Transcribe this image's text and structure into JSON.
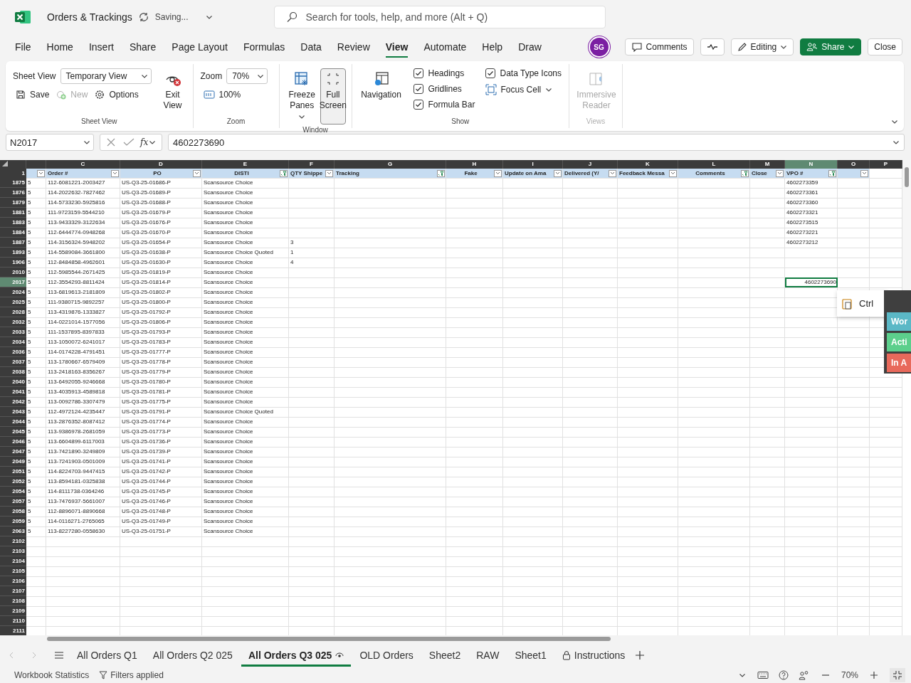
{
  "title_bar": {
    "document_title": "Orders & Trackings",
    "save_status": "Saving...",
    "search": {
      "placeholder": "Search for tools, help, and more (Alt + Q)"
    }
  },
  "menu_tabs": [
    {
      "label": "File",
      "selected": false
    },
    {
      "label": "Home",
      "selected": false
    },
    {
      "label": "Insert",
      "selected": false
    },
    {
      "label": "Share",
      "selected": false
    },
    {
      "label": "Page Layout",
      "selected": false
    },
    {
      "label": "Formulas",
      "selected": false
    },
    {
      "label": "Data",
      "selected": false
    },
    {
      "label": "Review",
      "selected": false
    },
    {
      "label": "View",
      "selected": true
    },
    {
      "label": "Automate",
      "selected": false
    },
    {
      "label": "Help",
      "selected": false
    },
    {
      "label": "Draw",
      "selected": false
    }
  ],
  "account": {
    "initials": "SG"
  },
  "actions": [
    {
      "kind": "comments",
      "label": "Comments"
    },
    {
      "kind": "activity"
    },
    {
      "kind": "editing",
      "label": "Editing"
    },
    {
      "kind": "share",
      "label": "Share"
    },
    {
      "kind": "close",
      "label": "Close"
    }
  ],
  "ribbon": {
    "sheet_view": {
      "label": "Sheet View",
      "field_label": "Sheet View",
      "view_value": "Temporary View",
      "exit": "Exit View",
      "buttons": [
        {
          "kind": "save",
          "label": "Save",
          "disabled": false
        },
        {
          "kind": "new",
          "label": "New",
          "disabled": true
        },
        {
          "kind": "options",
          "label": "Options",
          "disabled": false
        }
      ]
    },
    "zoom": {
      "label": "Zoom",
      "field_label": "Zoom",
      "value": "70%",
      "reset": "100%"
    },
    "window": {
      "label": "Window",
      "freeze": "Freeze Panes",
      "full_screen": {
        "label": "Full Screen",
        "selected": true
      }
    },
    "show": {
      "label": "Show",
      "navigation": "Navigation",
      "checks": [
        {
          "label": "Headings",
          "checked": true
        },
        {
          "label": "Gridlines",
          "checked": true
        },
        {
          "label": "Formula Bar",
          "checked": true
        },
        {
          "label": "Data Type Icons",
          "checked": true
        }
      ],
      "focus_cell": "Focus Cell"
    },
    "views": {
      "label": "Views",
      "immersive": "Immersive Reader",
      "disabled": true
    }
  },
  "formula_bar": {
    "name_box": "N2017",
    "function_label": "fx",
    "formula": "4602273690"
  },
  "grid": {
    "header_row": "1",
    "columns": [
      {
        "filtered": false,
        "selected": false
      },
      {
        "letter": "C",
        "header": "Order #",
        "filtered": false,
        "selected": false
      },
      {
        "letter": "D",
        "header": "PO",
        "filtered": false,
        "selected": false
      },
      {
        "letter": "E",
        "header": "DISTI",
        "filtered": true,
        "selected": false
      },
      {
        "letter": "F",
        "header": "QTY Shippe",
        "filtered": false,
        "selected": false
      },
      {
        "letter": "G",
        "header": "Tracking",
        "filtered": true,
        "selected": false
      },
      {
        "letter": "H",
        "header": "Fake",
        "filtered": false,
        "selected": false
      },
      {
        "letter": "I",
        "header": "Update on Ama",
        "filtered": false,
        "selected": false
      },
      {
        "letter": "J",
        "header": "Delivered (Y/",
        "filtered": false,
        "selected": false
      },
      {
        "letter": "K",
        "header": "Feedback Messa",
        "filtered": false,
        "selected": false
      },
      {
        "letter": "L",
        "header": "Comments",
        "filtered": true,
        "selected": false
      },
      {
        "letter": "M",
        "header": "Close",
        "filtered": false,
        "selected": false
      },
      {
        "letter": "N",
        "header": "VPO #",
        "filtered": true,
        "selected": true
      },
      {
        "letter": "O",
        "filtered": false,
        "selected": false
      },
      {
        "letter": "P",
        "selected": false
      }
    ],
    "rows": [
      {
        "row": "1875",
        "selected": false,
        "b": "5",
        "order_no": "112-6081221-2003427",
        "po": "US-Q3-25-01686-P",
        "disti": "Scansource Choice",
        "vpo": "4602273359"
      },
      {
        "row": "1876",
        "selected": false,
        "b": "5",
        "order_no": "114-2022632-7827462",
        "po": "US-Q3-25-01689-P",
        "disti": "Scansource Choice",
        "vpo": "4602273361"
      },
      {
        "row": "1879",
        "selected": false,
        "b": "5",
        "order_no": "114-5733230-5925816",
        "po": "US-Q3-25-01688-P",
        "disti": "Scansource Choice",
        "vpo": "4602273360"
      },
      {
        "row": "1881",
        "selected": false,
        "b": "5",
        "order_no": "111-9723159-5544210",
        "po": "US-Q3-25-01679-P",
        "disti": "Scansource Choice",
        "vpo": "4602273321"
      },
      {
        "row": "1883",
        "selected": false,
        "b": "5",
        "order_no": "113-9433329-3122634",
        "po": "US-Q3-25-01676-P",
        "disti": "Scansource Choice",
        "vpo": "4602273515"
      },
      {
        "row": "1884",
        "selected": false,
        "b": "5",
        "order_no": "112-6444774-0948268",
        "po": "US-Q3-25-01670-P",
        "disti": "Scansource Choice",
        "vpo": "4602273221"
      },
      {
        "row": "1887",
        "selected": false,
        "b": "5",
        "order_no": "114-3156324-5948202",
        "po": "US-Q3-25-01654-P",
        "disti": "Scansource Choice",
        "qty_shipped": "3",
        "vpo": "4602273212"
      },
      {
        "row": "1893",
        "selected": false,
        "b": "5",
        "order_no": "114-5589084-3661800",
        "po": "US-Q3-25-01638-P",
        "disti": "Scansource Choice Quoted",
        "qty_shipped": "1"
      },
      {
        "row": "1906",
        "selected": false,
        "b": "5",
        "order_no": "112-8484858-4962601",
        "po": "US-Q3-25-01630-P",
        "disti": "Scansource Choice",
        "qty_shipped": "4"
      },
      {
        "row": "2010",
        "selected": false,
        "b": "5",
        "order_no": "112-5985544-2671425",
        "po": "US-Q3-25-01819-P",
        "disti": "Scansource Choice"
      },
      {
        "row": "2017",
        "selected": true,
        "b": "5",
        "order_no": "112-3554293-8811424",
        "po": "US-Q3-25-01814-P",
        "disti": "Scansource Choice",
        "vpo": "4602273690"
      },
      {
        "row": "2024",
        "selected": false,
        "b": "5",
        "order_no": "113-6819613-2181809",
        "po": "US-Q3-25-01802-P",
        "disti": "Scansource Choice"
      },
      {
        "row": "2025",
        "selected": false,
        "b": "5",
        "order_no": "111-9380715-9892257",
        "po": "US-Q3-25-01800-P",
        "disti": "Scansource Choice"
      },
      {
        "row": "2028",
        "selected": false,
        "b": "5",
        "order_no": "113-4319876-1333827",
        "po": "US-Q3-25-01792-P",
        "disti": "Scansource Choice"
      },
      {
        "row": "2032",
        "selected": false,
        "b": "5",
        "order_no": "114-0221014-1577056",
        "po": "US-Q3-25-01806-P",
        "disti": "Scansource Choice"
      },
      {
        "row": "2033",
        "selected": false,
        "b": "5",
        "order_no": "111-1537895-8397833",
        "po": "US-Q3-25-01793-P",
        "disti": "Scansource Choice"
      },
      {
        "row": "2034",
        "selected": false,
        "b": "5",
        "order_no": "113-1050072-6241017",
        "po": "US-Q3-25-01783-P",
        "disti": "Scansource Choice"
      },
      {
        "row": "2036",
        "selected": false,
        "b": "5",
        "order_no": "114-0174228-4791451",
        "po": "US-Q3-25-01777-P",
        "disti": "Scansource Choice"
      },
      {
        "row": "2037",
        "selected": false,
        "b": "5",
        "order_no": "113-1780667-6579409",
        "po": "US-Q3-25-01778-P",
        "disti": "Scansource Choice"
      },
      {
        "row": "2038",
        "selected": false,
        "b": "5",
        "order_no": "113-2418163-8356267",
        "po": "US-Q3-25-01779-P",
        "disti": "Scansource Choice"
      },
      {
        "row": "2040",
        "selected": false,
        "b": "5",
        "order_no": "113-6492055-9246668",
        "po": "US-Q3-25-01780-P",
        "disti": "Scansource Choice"
      },
      {
        "row": "2041",
        "selected": false,
        "b": "5",
        "order_no": "113-4035913-4589818",
        "po": "US-Q3-25-01781-P",
        "disti": "Scansource Choice"
      },
      {
        "row": "2042",
        "selected": false,
        "b": "5",
        "order_no": "113-0092786-3307479",
        "po": "US-Q3-25-01775-P",
        "disti": "Scansource Choice"
      },
      {
        "row": "2043",
        "selected": false,
        "b": "5",
        "order_no": "112-4972124-4235447",
        "po": "US-Q3-25-01791-P",
        "disti": "Scansource Choice Quoted"
      },
      {
        "row": "2044",
        "selected": false,
        "b": "5",
        "order_no": "113-2876352-8087412",
        "po": "US-Q3-25-01774-P",
        "disti": "Scansource Choice"
      },
      {
        "row": "2045",
        "selected": false,
        "b": "5",
        "order_no": "113-9386978-2681059",
        "po": "US-Q3-25-01773-P",
        "disti": "Scansource Choice"
      },
      {
        "row": "2046",
        "selected": false,
        "b": "5",
        "order_no": "113-6604899-6117003",
        "po": "US-Q3-25-01736-P",
        "disti": "Scansource Choice"
      },
      {
        "row": "2047",
        "selected": false,
        "b": "5",
        "order_no": "113-7421890-3249809",
        "po": "US-Q3-25-01739-P",
        "disti": "Scansource Choice"
      },
      {
        "row": "2049",
        "selected": false,
        "b": "5",
        "order_no": "113-7241903-0501009",
        "po": "US-Q3-25-01741-P",
        "disti": "Scansource Choice"
      },
      {
        "row": "2051",
        "selected": false,
        "b": "5",
        "order_no": "114-8224703-9447415",
        "po": "US-Q3-25-01742-P",
        "disti": "Scansource Choice"
      },
      {
        "row": "2052",
        "selected": false,
        "b": "5",
        "order_no": "113-8594181-0325838",
        "po": "US-Q3-25-01744-P",
        "disti": "Scansource Choice"
      },
      {
        "row": "2054",
        "selected": false,
        "b": "5",
        "order_no": "114-8111738-0364246",
        "po": "US-Q3-25-01745-P",
        "disti": "Scansource Choice"
      },
      {
        "row": "2057",
        "selected": false,
        "b": "5",
        "order_no": "113-7476937-5661007",
        "po": "US-Q3-25-01746-P",
        "disti": "Scansource Choice"
      },
      {
        "row": "2058",
        "selected": false,
        "b": "5",
        "order_no": "112-8896071-8890668",
        "po": "US-Q3-25-01748-P",
        "disti": "Scansource Choice"
      },
      {
        "row": "2059",
        "selected": false,
        "b": "5",
        "order_no": "114-0116271-2765065",
        "po": "US-Q3-25-01749-P",
        "disti": "Scansource Choice"
      },
      {
        "row": "2063",
        "selected": false,
        "b": "5",
        "order_no": "113-8227280-0558630",
        "po": "US-Q3-25-01751-P",
        "disti": "Scansource Choice"
      },
      {
        "row": "2102",
        "selected": false
      },
      {
        "row": "2103",
        "selected": false
      },
      {
        "row": "2104",
        "selected": false
      },
      {
        "row": "2105",
        "selected": false
      },
      {
        "row": "2106",
        "selected": false
      },
      {
        "row": "2107",
        "selected": false
      },
      {
        "row": "2108",
        "selected": false
      },
      {
        "row": "2109",
        "selected": false
      },
      {
        "row": "2110",
        "selected": false
      },
      {
        "row": "2111",
        "selected": false
      }
    ],
    "paste_options": {
      "label": "Ctrl"
    },
    "side_panel": {
      "buttons": [
        {
          "label": "Wor",
          "color": "#5bb8c6"
        },
        {
          "label": "Acti",
          "color": "#5ccf8c"
        },
        {
          "label": "In A",
          "color": "#e8695b"
        }
      ]
    }
  },
  "sheet_tabs": [
    {
      "label": "All Orders Q1",
      "selected": false,
      "kind": "plain"
    },
    {
      "label": "All Orders Q2 025",
      "selected": false,
      "kind": "plain"
    },
    {
      "label": "All Orders Q3 025",
      "selected": true,
      "kind": "viewing"
    },
    {
      "label": "OLD Orders",
      "selected": false,
      "kind": "plain"
    },
    {
      "label": "Sheet2",
      "selected": false,
      "kind": "plain"
    },
    {
      "label": "RAW",
      "selected": false,
      "kind": "plain"
    },
    {
      "label": "Sheet1",
      "selected": false,
      "kind": "plain"
    },
    {
      "label": "Instructions",
      "selected": false,
      "kind": "locked"
    }
  ],
  "status_bar": {
    "items": [
      {
        "kind": "text",
        "label": "Workbook Statistics"
      },
      {
        "kind": "filter",
        "label": "Filters applied"
      }
    ],
    "zoom": "70%"
  }
}
